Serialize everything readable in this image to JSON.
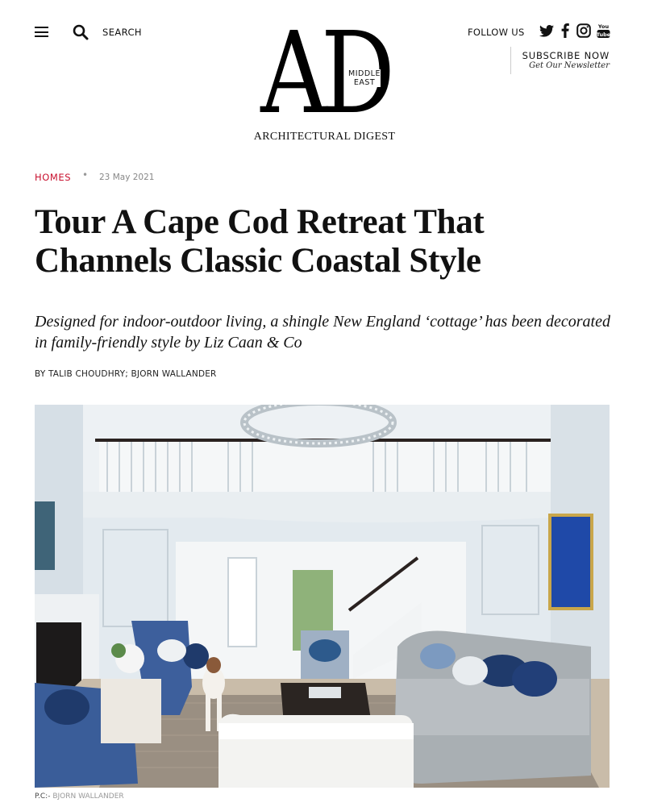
{
  "header": {
    "search_label": "SEARCH",
    "follow_label": "FOLLOW US",
    "subscribe_label": "SUBSCRIBE NOW",
    "newsletter_label": "Get Our Newsletter",
    "social": [
      "twitter-icon",
      "facebook-icon",
      "instagram-icon",
      "youtube-icon"
    ]
  },
  "logo": {
    "letters": "AD",
    "edition": "MIDDLE EAST",
    "name": "ARCHITECTURAL DIGEST"
  },
  "article": {
    "category": "HOMES",
    "date": "23 May 2021",
    "title": "Tour A Cape Cod Retreat That Channels Classic Coastal Style",
    "dek": "Designed for indoor-outdoor living, a shingle New England ‘cottage’ has been decorated in family-friendly style by Liz Caan & Co",
    "byline": "BY TALIB CHOUDHRY; BJORN WALLANDER",
    "photo_credit_prefix": "P.C:-",
    "photo_credit_name": "BJORN WALLANDER"
  },
  "colors": {
    "accent": "#c8102e",
    "text": "#111111"
  }
}
